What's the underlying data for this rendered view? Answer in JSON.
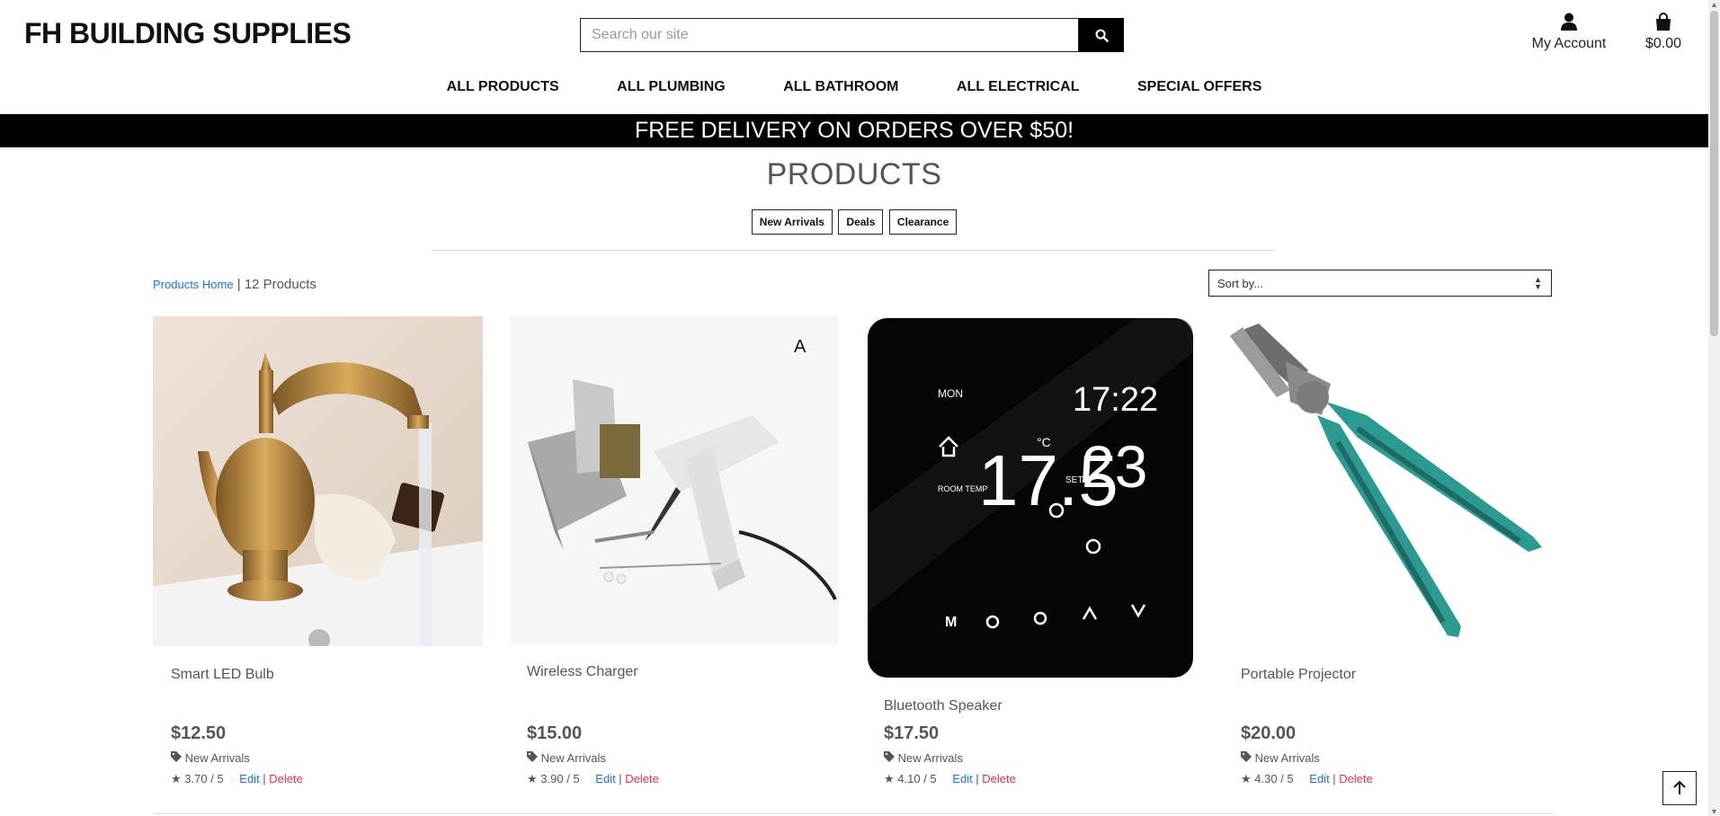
{
  "header": {
    "logo": "FH BUILDING SUPPLIES",
    "search_placeholder": "Search our site",
    "account_label": "My Account",
    "cart_total": "$0.00"
  },
  "nav": [
    "ALL PRODUCTS",
    "ALL PLUMBING",
    "ALL BATHROOM",
    "ALL ELECTRICAL",
    "SPECIAL OFFERS"
  ],
  "banner": "FREE DELIVERY ON ORDERS OVER $50!",
  "page": {
    "title": "PRODUCTS",
    "filter_tags": [
      "New Arrivals",
      "Deals",
      "Clearance"
    ],
    "breadcrumb_link": "Products Home",
    "count_text": "12 Products",
    "sort_label": "Sort by..."
  },
  "products": [
    {
      "name": "Smart LED Bulb",
      "price": "$12.50",
      "category": "New Arrivals",
      "rating": "3.70 / 5",
      "edit": "Edit",
      "delete": "Delete",
      "image": "brass-faucet"
    },
    {
      "name": "Wireless Charger",
      "price": "$15.00",
      "category": "New Arrivals",
      "rating": "3.90 / 5",
      "edit": "Edit",
      "delete": "Delete",
      "image": "soldering-station"
    },
    {
      "name": "Bluetooth Speaker",
      "price": "$17.50",
      "category": "New Arrivals",
      "rating": "4.10 / 5",
      "edit": "Edit",
      "delete": "Delete",
      "image": "thermostat",
      "display": {
        "day": "MON",
        "time": "17:22",
        "temp1": "17.5",
        "temp2": "23",
        "unit": "°C",
        "set": "SET",
        "room": "ROOM TEMP"
      }
    },
    {
      "name": "Portable Projector",
      "price": "$20.00",
      "category": "New Arrivals",
      "rating": "4.30 / 5",
      "edit": "Edit",
      "delete": "Delete",
      "image": "pliers"
    }
  ],
  "image_letter": "A",
  "colors": {
    "link": "#1a73e8",
    "delete": "#dc3545",
    "banner_bg": "#000000"
  }
}
